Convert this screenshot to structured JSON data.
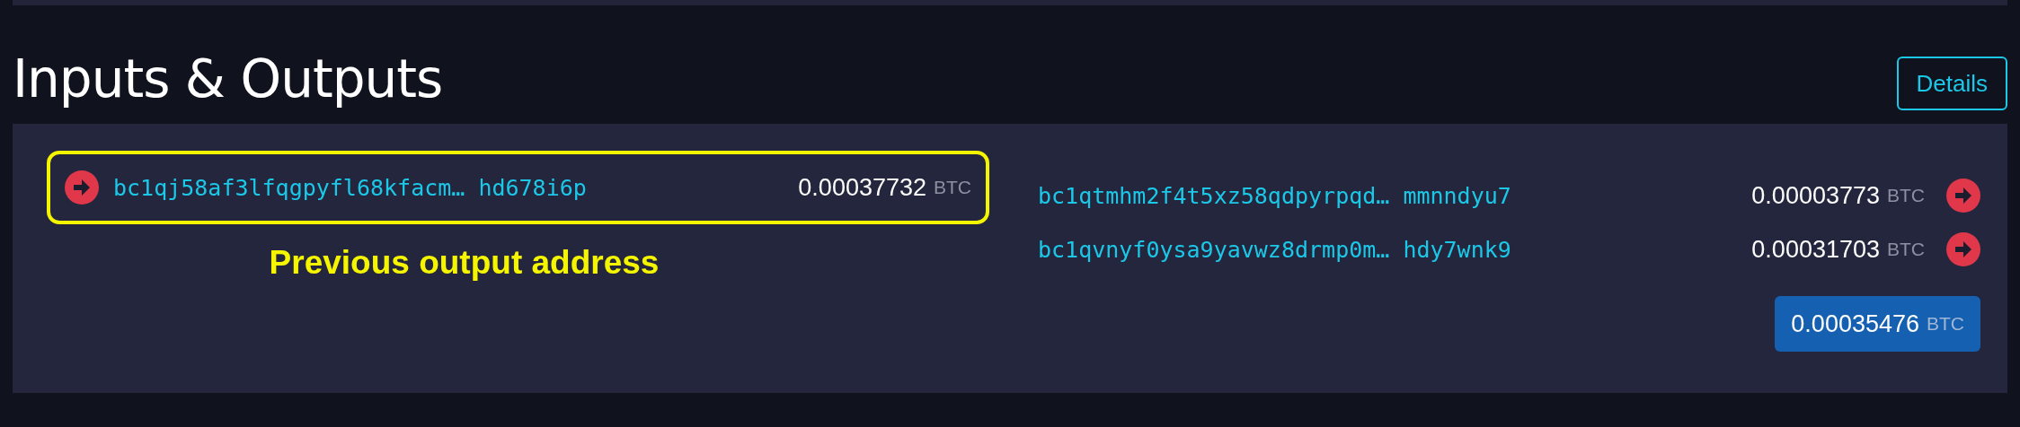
{
  "section": {
    "title": "Inputs & Outputs",
    "details_button": "Details"
  },
  "inputs": [
    {
      "address": "bc1qj58af3lfqgpyfl68kfacm… hd678i6p",
      "amount": "0.00037732",
      "unit": "BTC",
      "highlighted": true
    }
  ],
  "annotation": "Previous output address",
  "outputs": [
    {
      "address": "bc1qtmhm2f4t5xz58qdpyrpqd… mmnndyu7",
      "amount": "0.00003773",
      "unit": "BTC"
    },
    {
      "address": "bc1qvnyf0ysa9yavwz8drmp0m… hdy7wnk9",
      "amount": "0.00031703",
      "unit": "BTC"
    }
  ],
  "total": {
    "amount": "0.00035476",
    "unit": "BTC"
  }
}
